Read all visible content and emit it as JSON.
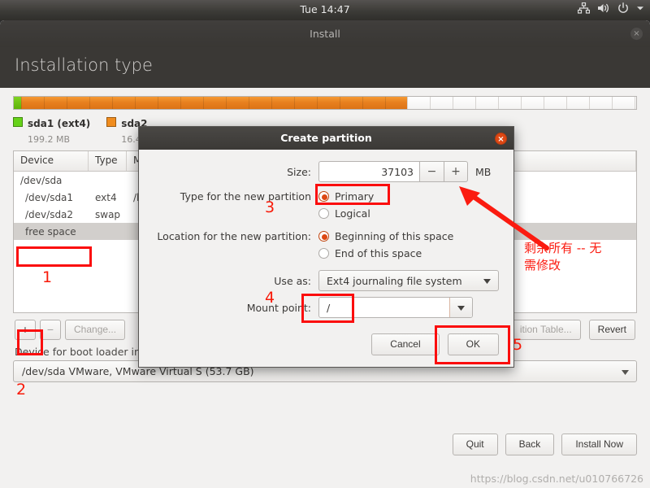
{
  "system_bar": {
    "clock": "Tue 14:47",
    "icons": [
      "network-icon",
      "volume-icon",
      "power-icon",
      "chevron-down-icon"
    ]
  },
  "window": {
    "title": "Install",
    "close_label": "×",
    "heading": "Installation type"
  },
  "partition_bar": {
    "segments": [
      {
        "name": "sda1",
        "color": "#66d219",
        "width_pct": 1.2
      },
      {
        "name": "sda2",
        "color": "#f08c1e",
        "width_pct": 62.0
      },
      {
        "name": "free",
        "color": "#ffffff",
        "width_pct": 36.8
      }
    ],
    "legend": [
      {
        "swatch": "#66d219",
        "name": "sda1 (ext4)",
        "size": "199.2 MB"
      },
      {
        "swatch": "#f08c1e",
        "name": "sda2",
        "size": "16.4"
      }
    ]
  },
  "partition_table": {
    "headers": [
      "Device",
      "Type",
      "M"
    ],
    "rows": [
      {
        "device": "/dev/sda",
        "type": "",
        "mount": "",
        "selected": false,
        "indent": 0
      },
      {
        "device": "/dev/sda1",
        "type": "ext4",
        "mount": "/b",
        "selected": false,
        "indent": 1
      },
      {
        "device": "/dev/sda2",
        "type": "swap",
        "mount": "",
        "selected": false,
        "indent": 1
      },
      {
        "device": "free space",
        "type": "",
        "mount": "",
        "selected": true,
        "indent": 1
      }
    ]
  },
  "toolbar": {
    "add_label": "+",
    "remove_label": "−",
    "change_label": "Change...",
    "new_partition_table_label": "ition Table...",
    "revert_label": "Revert"
  },
  "boot_loader": {
    "label": "Device for boot loader installation:",
    "value": "/dev/sda   VMware, VMware Virtual S (53.7 GB)"
  },
  "footer": {
    "quit_label": "Quit",
    "back_label": "Back",
    "install_label": "Install Now"
  },
  "dialog": {
    "title": "Create partition",
    "close_label": "×",
    "size": {
      "label": "Size:",
      "value": "37103",
      "unit": "MB",
      "minus_label": "−",
      "plus_label": "+"
    },
    "type_label": "Type for the new partition",
    "type_options": [
      {
        "label": "Primary",
        "selected": true
      },
      {
        "label": "Logical",
        "selected": false
      }
    ],
    "location_label": "Location for the new partition:",
    "location_options": [
      {
        "label": "Beginning of this space",
        "selected": true
      },
      {
        "label": "End of this space",
        "selected": false
      }
    ],
    "use_as": {
      "label": "Use as:",
      "value": "Ext4 journaling file system"
    },
    "mount_point": {
      "label": "Mount point:",
      "value": "/"
    },
    "cancel_label": "Cancel",
    "ok_label": "OK"
  },
  "annotations": {
    "numbers": [
      "1",
      "2",
      "3",
      "4",
      "5"
    ],
    "note_cn": "剩余所有 -- 无需修改",
    "accent_color": "#fb0d0d"
  },
  "watermark": "https://blog.csdn.net/u010766726"
}
